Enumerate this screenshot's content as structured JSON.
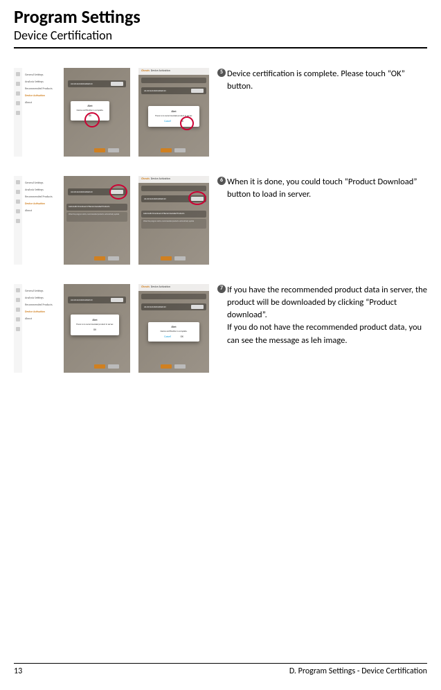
{
  "header": {
    "title": "Program Settings",
    "subtitle": "Device Certification"
  },
  "menu": {
    "general": "General Settings",
    "analysis": "Analysis Settings",
    "recommended": "Recommended Products",
    "activation": "Device Activation",
    "about": "About"
  },
  "screens": {
    "brand": "Chowis",
    "section": "Device Activation",
    "device_list_label": "Device List",
    "device_id": "AS-1012A1240102060123",
    "product_download_btn": "Product Download",
    "alert1": {
      "title": "Alert",
      "msg": "Device certification is complete.",
      "ok": "OK"
    },
    "alert2": {
      "title": "Alert",
      "msg": "There is no recommended product in server.",
      "cancel": "Cancel",
      "ok": "OK"
    },
    "alert3": {
      "title": "Alert",
      "msg": "There is no recommended product in server.",
      "ok": "OK"
    },
    "alert4": {
      "title": "Alert",
      "msg": "Device certification is complete.",
      "cancel": "Cancel",
      "ok": "OK"
    },
    "auto_dl": "Automatic Download of Recommended Products",
    "auto_dl_note": "When the program starts, recommended products automatically update"
  },
  "steps": {
    "s5": {
      "n": "5",
      "text": "Device certification is complete. Please touch “OK” button."
    },
    "s6": {
      "n": "6",
      "text": "When it is done, you could touch  “Product Download” button to load in  server."
    },
    "s7": {
      "n": "7",
      "text": "If you have the recommended product data in server, the product will be  downloaded by clicking “Product  download”.\nIf you do not have the recommended product data, you can see the message as leh image."
    }
  },
  "footer": {
    "page": "13",
    "section": "D. Program Settings - Device Certification"
  }
}
